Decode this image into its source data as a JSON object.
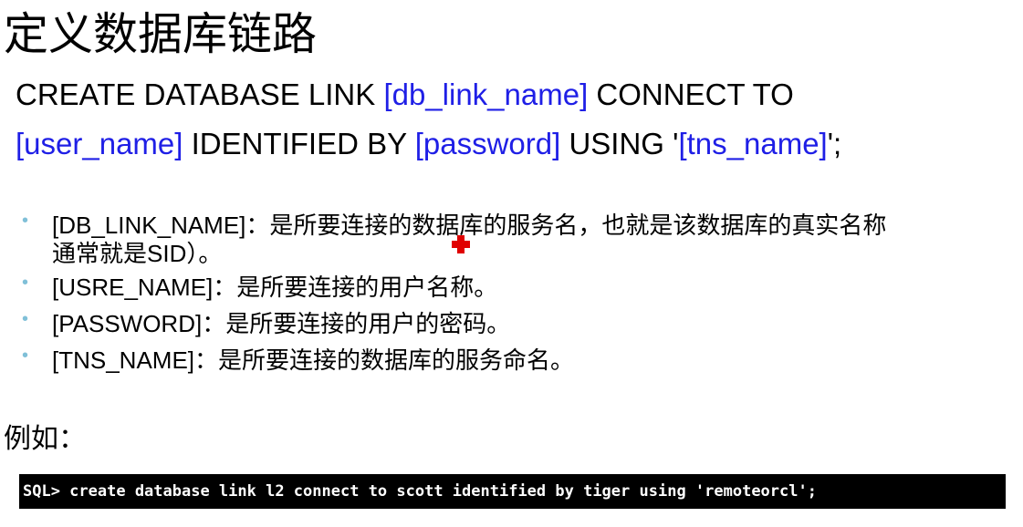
{
  "title": "定义数据库链路",
  "syntax": {
    "line1": {
      "t1": "CREATE DATABASE LINK ",
      "p1": "[db_link_name]",
      "t2": " CONNECT TO"
    },
    "line2": {
      "p1": "[user_name]",
      "t1": " IDENTIFIED BY ",
      "p2": "[password]",
      "t2": " USING '",
      "p3": "[tns_name]",
      "t3": "';"
    }
  },
  "bullets": [
    {
      "text": "[DB_LINK_NAME]：是所要连接的数据库的服务名，也就是该数据库的真实名称",
      "continuation": "通常就是SID）。"
    },
    {
      "text": "[USRE_NAME]：是所要连接的用户名称。"
    },
    {
      "text": "[PASSWORD]：是所要连接的用户的密码。"
    },
    {
      "text": "[TNS_NAME]：是所要连接的数据库的服务命名。"
    }
  ],
  "bullet_glyph": "•",
  "example_label": "例如：",
  "console": {
    "command": "SQL> create database link l2 connect to scott identified by tiger using 'remoteorcl';"
  },
  "colors": {
    "parameter": "#1f1fe6",
    "bullet": "#80c0d8",
    "console_bg": "#000000",
    "console_fg": "#ffffff",
    "cursor": "#e00000"
  },
  "icons": {
    "cursor": "red-cross-cursor-icon"
  }
}
